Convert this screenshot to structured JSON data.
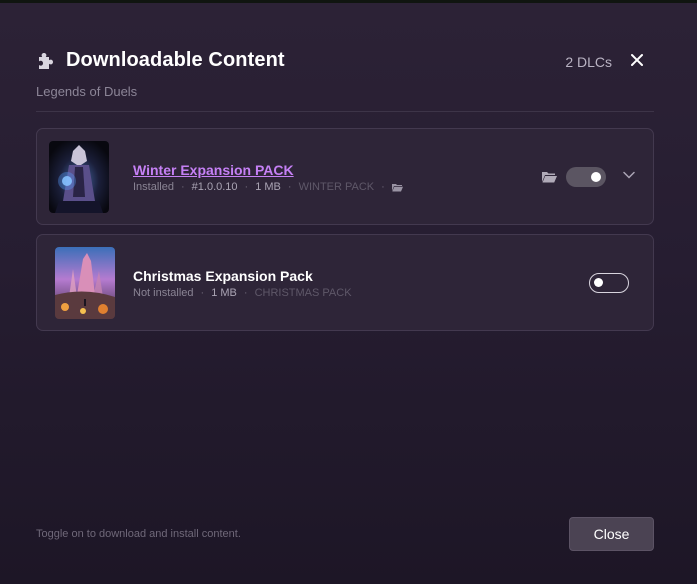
{
  "dialog": {
    "title": "Downloadable Content",
    "subtitle": "Legends of Duels",
    "dlc_count": "2 DLCs",
    "footer_hint": "Toggle on to download and install content.",
    "close_label": "Close"
  },
  "dlcs": [
    {
      "name": "Winter Expansion PACK",
      "status": "Installed",
      "version": "#1.0.0.10",
      "size": "1 MB",
      "tag": "WINTER PACK",
      "enabled": true,
      "link_color": "#c580f5"
    },
    {
      "name": "Christmas Expansion Pack",
      "status": "Not installed",
      "size": "1 MB",
      "tag": "CHRISTMAS PACK",
      "enabled": false
    }
  ],
  "icons": {
    "header": "puzzle-icon",
    "close": "close-icon",
    "folder": "folder-icon",
    "expand": "chevron-down-icon"
  }
}
